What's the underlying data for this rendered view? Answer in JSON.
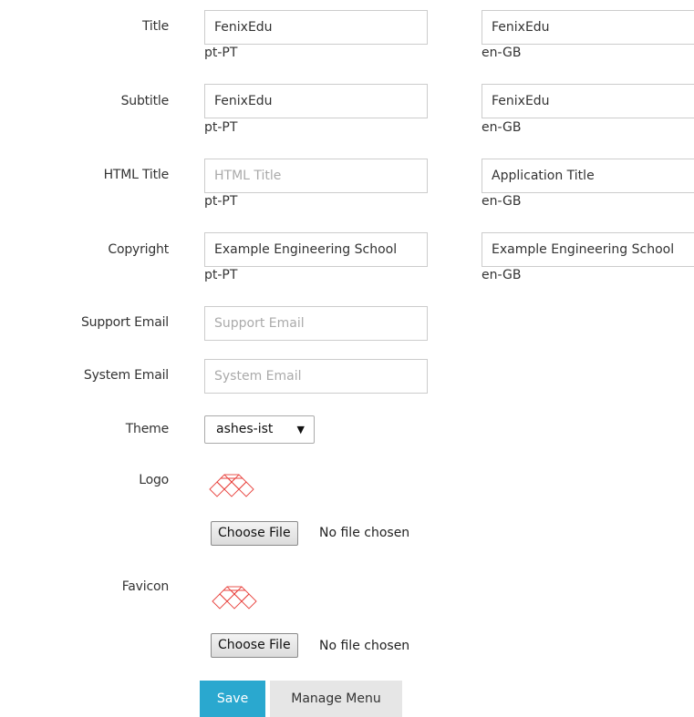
{
  "form": {
    "title": {
      "label": "Title",
      "pt": {
        "value": "FenixEdu",
        "locale": "pt-PT"
      },
      "en": {
        "value": "FenixEdu",
        "locale": "en-GB"
      }
    },
    "subtitle": {
      "label": "Subtitle",
      "pt": {
        "value": "FenixEdu",
        "locale": "pt-PT"
      },
      "en": {
        "value": "FenixEdu",
        "locale": "en-GB"
      }
    },
    "html_title": {
      "label": "HTML Title",
      "pt": {
        "value": "",
        "placeholder": "HTML Title",
        "locale": "pt-PT"
      },
      "en": {
        "value": "Application Title",
        "locale": "en-GB"
      }
    },
    "copyright": {
      "label": "Copyright",
      "pt": {
        "value": "Example Engineering School",
        "locale": "pt-PT"
      },
      "en": {
        "value": "Example Engineering School",
        "locale": "en-GB"
      }
    },
    "support_email": {
      "label": "Support Email",
      "value": "",
      "placeholder": "Support Email"
    },
    "system_email": {
      "label": "System Email",
      "value": "",
      "placeholder": "System Email"
    },
    "theme": {
      "label": "Theme",
      "selected": "ashes-ist"
    },
    "logo": {
      "label": "Logo",
      "icon": "logo-lattice-icon",
      "choose_label": "Choose File",
      "status": "No file chosen"
    },
    "favicon": {
      "label": "Favicon",
      "icon": "favicon-lattice-icon",
      "choose_label": "Choose File",
      "status": "No file chosen"
    }
  },
  "actions": {
    "save_label": "Save",
    "manage_menu_label": "Manage Menu"
  },
  "colors": {
    "primary": "#2aa8cf",
    "logo_stroke": "#e8413c",
    "border": "#cccccc",
    "placeholder": "#aaaaaa"
  }
}
